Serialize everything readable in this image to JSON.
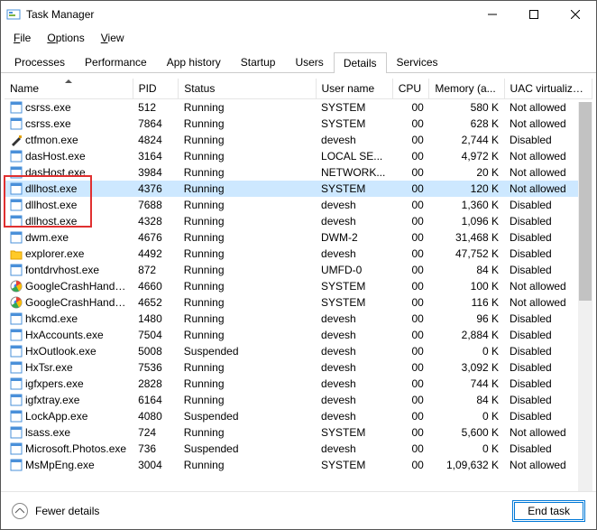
{
  "window": {
    "title": "Task Manager"
  },
  "menu": {
    "file": "File",
    "options": "Options",
    "view": "View"
  },
  "tabs": {
    "processes": "Processes",
    "performance": "Performance",
    "apphistory": "App history",
    "startup": "Startup",
    "users": "Users",
    "details": "Details",
    "services": "Services"
  },
  "columns": {
    "name": "Name",
    "pid": "PID",
    "status": "Status",
    "user": "User name",
    "cpu": "CPU",
    "mem": "Memory (a...",
    "uac": "UAC virtualizat..."
  },
  "footer": {
    "fewer": "Fewer details",
    "endtask": "End task"
  },
  "rows": [
    {
      "icon": "app",
      "name": "csrss.exe",
      "pid": "512",
      "status": "Running",
      "user": "SYSTEM",
      "cpu": "00",
      "mem": "580 K",
      "uac": "Not allowed"
    },
    {
      "icon": "app",
      "name": "csrss.exe",
      "pid": "7864",
      "status": "Running",
      "user": "SYSTEM",
      "cpu": "00",
      "mem": "628 K",
      "uac": "Not allowed"
    },
    {
      "icon": "pen",
      "name": "ctfmon.exe",
      "pid": "4824",
      "status": "Running",
      "user": "devesh",
      "cpu": "00",
      "mem": "2,744 K",
      "uac": "Disabled"
    },
    {
      "icon": "app",
      "name": "dasHost.exe",
      "pid": "3164",
      "status": "Running",
      "user": "LOCAL SE...",
      "cpu": "00",
      "mem": "4,972 K",
      "uac": "Not allowed"
    },
    {
      "icon": "app",
      "name": "dasHost.exe",
      "pid": "3984",
      "status": "Running",
      "user": "NETWORK...",
      "cpu": "00",
      "mem": "20 K",
      "uac": "Not allowed"
    },
    {
      "icon": "app",
      "name": "dllhost.exe",
      "pid": "4376",
      "status": "Running",
      "user": "SYSTEM",
      "cpu": "00",
      "mem": "120 K",
      "uac": "Not allowed",
      "selected": true
    },
    {
      "icon": "app",
      "name": "dllhost.exe",
      "pid": "7688",
      "status": "Running",
      "user": "devesh",
      "cpu": "00",
      "mem": "1,360 K",
      "uac": "Disabled"
    },
    {
      "icon": "app",
      "name": "dllhost.exe",
      "pid": "4328",
      "status": "Running",
      "user": "devesh",
      "cpu": "00",
      "mem": "1,096 K",
      "uac": "Disabled"
    },
    {
      "icon": "app",
      "name": "dwm.exe",
      "pid": "4676",
      "status": "Running",
      "user": "DWM-2",
      "cpu": "00",
      "mem": "31,468 K",
      "uac": "Disabled"
    },
    {
      "icon": "folder",
      "name": "explorer.exe",
      "pid": "4492",
      "status": "Running",
      "user": "devesh",
      "cpu": "00",
      "mem": "47,752 K",
      "uac": "Disabled"
    },
    {
      "icon": "app",
      "name": "fontdrvhost.exe",
      "pid": "872",
      "status": "Running",
      "user": "UMFD-0",
      "cpu": "00",
      "mem": "84 K",
      "uac": "Disabled"
    },
    {
      "icon": "google",
      "name": "GoogleCrashHandler...",
      "pid": "4660",
      "status": "Running",
      "user": "SYSTEM",
      "cpu": "00",
      "mem": "100 K",
      "uac": "Not allowed"
    },
    {
      "icon": "google",
      "name": "GoogleCrashHandler...",
      "pid": "4652",
      "status": "Running",
      "user": "SYSTEM",
      "cpu": "00",
      "mem": "116 K",
      "uac": "Not allowed"
    },
    {
      "icon": "app",
      "name": "hkcmd.exe",
      "pid": "1480",
      "status": "Running",
      "user": "devesh",
      "cpu": "00",
      "mem": "96 K",
      "uac": "Disabled"
    },
    {
      "icon": "app",
      "name": "HxAccounts.exe",
      "pid": "7504",
      "status": "Running",
      "user": "devesh",
      "cpu": "00",
      "mem": "2,884 K",
      "uac": "Disabled"
    },
    {
      "icon": "app",
      "name": "HxOutlook.exe",
      "pid": "5008",
      "status": "Suspended",
      "user": "devesh",
      "cpu": "00",
      "mem": "0 K",
      "uac": "Disabled"
    },
    {
      "icon": "app",
      "name": "HxTsr.exe",
      "pid": "7536",
      "status": "Running",
      "user": "devesh",
      "cpu": "00",
      "mem": "3,092 K",
      "uac": "Disabled"
    },
    {
      "icon": "app",
      "name": "igfxpers.exe",
      "pid": "2828",
      "status": "Running",
      "user": "devesh",
      "cpu": "00",
      "mem": "744 K",
      "uac": "Disabled"
    },
    {
      "icon": "app",
      "name": "igfxtray.exe",
      "pid": "6164",
      "status": "Running",
      "user": "devesh",
      "cpu": "00",
      "mem": "84 K",
      "uac": "Disabled"
    },
    {
      "icon": "app",
      "name": "LockApp.exe",
      "pid": "4080",
      "status": "Suspended",
      "user": "devesh",
      "cpu": "00",
      "mem": "0 K",
      "uac": "Disabled"
    },
    {
      "icon": "app",
      "name": "lsass.exe",
      "pid": "724",
      "status": "Running",
      "user": "SYSTEM",
      "cpu": "00",
      "mem": "5,600 K",
      "uac": "Not allowed"
    },
    {
      "icon": "app",
      "name": "Microsoft.Photos.exe",
      "pid": "736",
      "status": "Suspended",
      "user": "devesh",
      "cpu": "00",
      "mem": "0 K",
      "uac": "Disabled"
    },
    {
      "icon": "app",
      "name": "MsMpEng.exe",
      "pid": "3004",
      "status": "Running",
      "user": "SYSTEM",
      "cpu": "00",
      "mem": "1,09,632 K",
      "uac": "Not allowed"
    }
  ]
}
